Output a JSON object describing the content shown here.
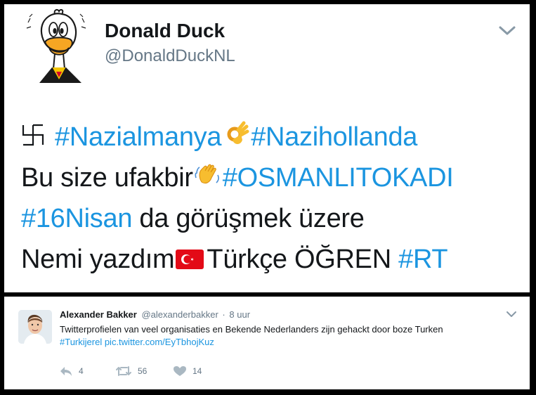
{
  "tweet": {
    "display_name": "Donald Duck",
    "handle": "@DonaldDuckNL",
    "avatar_icon": "donald-duck-avatar",
    "lines": [
      [
        {
          "kind": "icon",
          "name": "swastika-icon"
        },
        {
          "kind": "hashtag",
          "text": "#Nazialmanya"
        },
        {
          "kind": "icon",
          "name": "ok-hand-emoji"
        },
        {
          "kind": "hashtag",
          "text": "#Nazihollanda"
        }
      ],
      [
        {
          "kind": "text",
          "text": "Bu size ufakbir"
        },
        {
          "kind": "icon",
          "name": "waving-hand-emoji"
        },
        {
          "kind": "hashtag",
          "text": "#OSMANLITOKADI"
        }
      ],
      [
        {
          "kind": "hashtag",
          "text": "#16Nisan"
        },
        {
          "kind": "text",
          "text": " da görüşmek üzere"
        }
      ],
      [
        {
          "kind": "text",
          "text": "Nemi yazdım"
        },
        {
          "kind": "icon",
          "name": "turkey-flag-emoji"
        },
        {
          "kind": "text",
          "text": "Türkçe ÖĞREN "
        },
        {
          "kind": "hashtag",
          "text": "#RT"
        }
      ]
    ]
  },
  "reply": {
    "name": "Alexander Bakker",
    "handle": "@alexanderbakker",
    "separator": "·",
    "time": "8 uur",
    "text": "Twitterprofielen van veel organisaties en Bekende Nederlanders zijn gehackt door boze Turken",
    "hashtag": "#Turkijerel",
    "link": "pic.twitter.com/EyTbhojKuz",
    "actions": {
      "reply_count": "4",
      "retweet_count": "56",
      "like_count": "14"
    }
  },
  "colors": {
    "link": "#1b95e0",
    "text": "#14171a",
    "secondary": "#657786",
    "action_icon": "#aab8c2",
    "background": "#000000"
  }
}
